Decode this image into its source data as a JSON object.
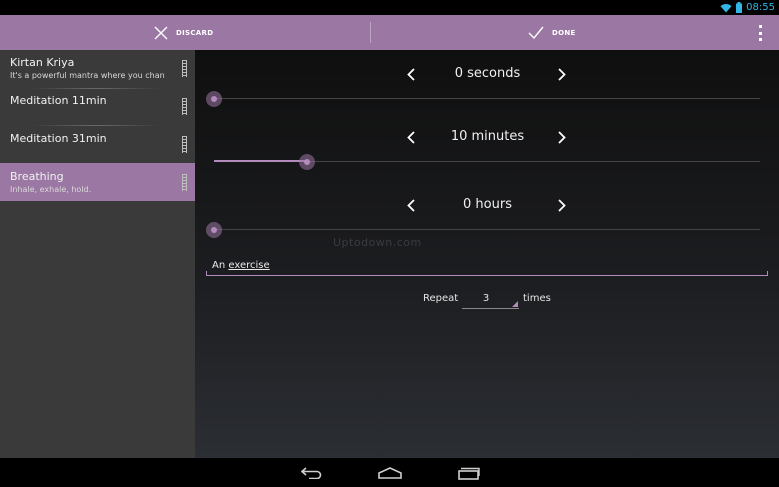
{
  "status_bar": {
    "time": "08:55"
  },
  "action_bar": {
    "discard_label": "DISCARD",
    "done_label": "DONE"
  },
  "exercises": [
    {
      "title": "Kirtan Kriya",
      "subtitle": "It's a powerful mantra where you chant...",
      "selected": false
    },
    {
      "title": "Meditation 11min",
      "subtitle": "",
      "selected": false
    },
    {
      "title": "Meditation 31min",
      "subtitle": "",
      "selected": false
    },
    {
      "title": "Breathing",
      "subtitle": "Inhale, exhale, hold.",
      "selected": true
    }
  ],
  "pickers": [
    {
      "label": "0 seconds",
      "slider_fraction": 0.0
    },
    {
      "label": "10 minutes",
      "slider_fraction": 0.17
    },
    {
      "label": "0 hours",
      "slider_fraction": 0.0
    }
  ],
  "watermark": "Uptodown.com",
  "description": {
    "prefix": "An ",
    "underlined": "exercise"
  },
  "repeat": {
    "label": "Repeat",
    "value": "3",
    "suffix": "times"
  },
  "colors": {
    "accent": "#9b77a3",
    "accent_light": "#b38cbd",
    "status_icon": "#33b5e5"
  }
}
